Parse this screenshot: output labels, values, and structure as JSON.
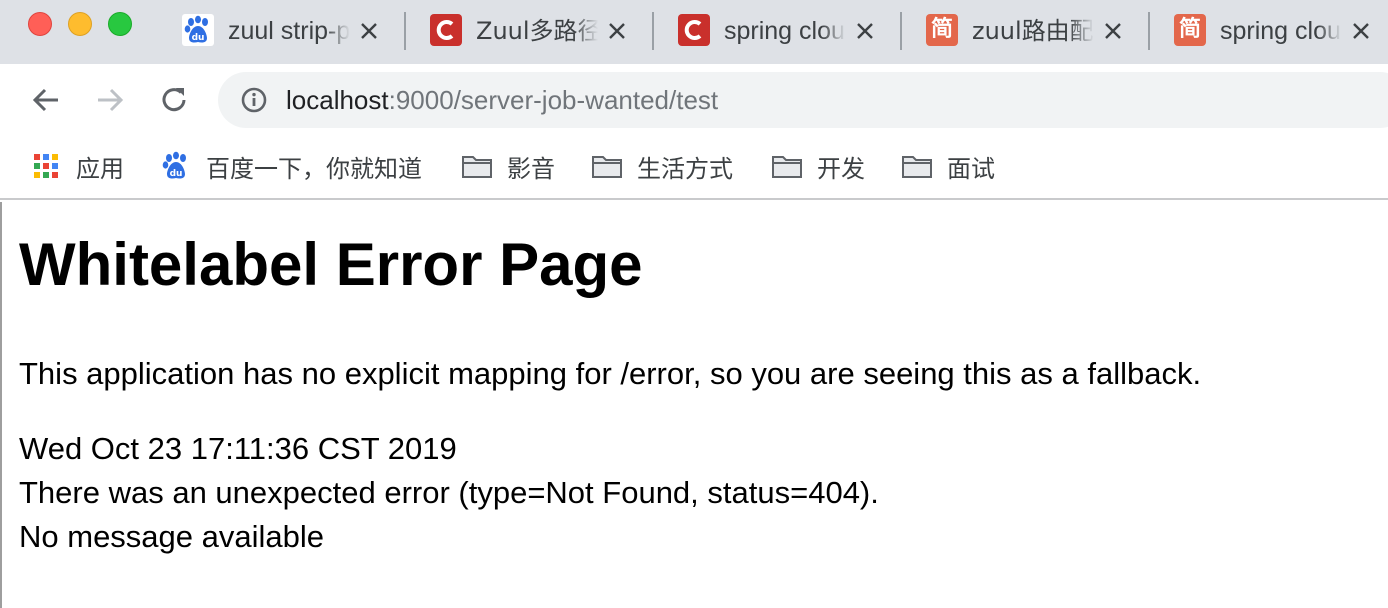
{
  "tabs": [
    {
      "title": "zuul strip-prefix",
      "favicon": "baidu-icon"
    },
    {
      "title": "Zuul多路径",
      "favicon": "csdn-icon"
    },
    {
      "title": "spring cloud",
      "favicon": "csdn-icon"
    },
    {
      "title": "zuul路由配",
      "favicon": "jianshu-icon",
      "favicon_text": "简"
    },
    {
      "title": "spring cloud",
      "favicon": "jianshu-icon",
      "favicon_text": "简"
    }
  ],
  "address_bar": {
    "host": "localhost",
    "rest": ":9000/server-job-wanted/test"
  },
  "bookmarks": [
    {
      "label": "应用",
      "icon": "apps-grid-icon"
    },
    {
      "label": "百度一下，你就知道",
      "icon": "baidu-icon"
    },
    {
      "label": "影音",
      "icon": "folder-icon"
    },
    {
      "label": "生活方式",
      "icon": "folder-icon"
    },
    {
      "label": "开发",
      "icon": "folder-icon"
    },
    {
      "label": "面试",
      "icon": "folder-icon"
    }
  ],
  "page": {
    "heading": "Whitelabel Error Page",
    "message": "This application has no explicit mapping for /error, so you are seeing this as a fallback.",
    "timestamp": "Wed Oct 23 17:11:36 CST 2019",
    "error_line": "There was an unexpected error (type=Not Found, status=404).",
    "detail": "No message available"
  },
  "colors": {
    "tabstrip": "#dee1e6",
    "omnibox": "#f1f3f4",
    "csdn_red": "#c9302c",
    "jianshu_orange": "#e3674b",
    "baidu_blue": "#2f6fe3"
  }
}
